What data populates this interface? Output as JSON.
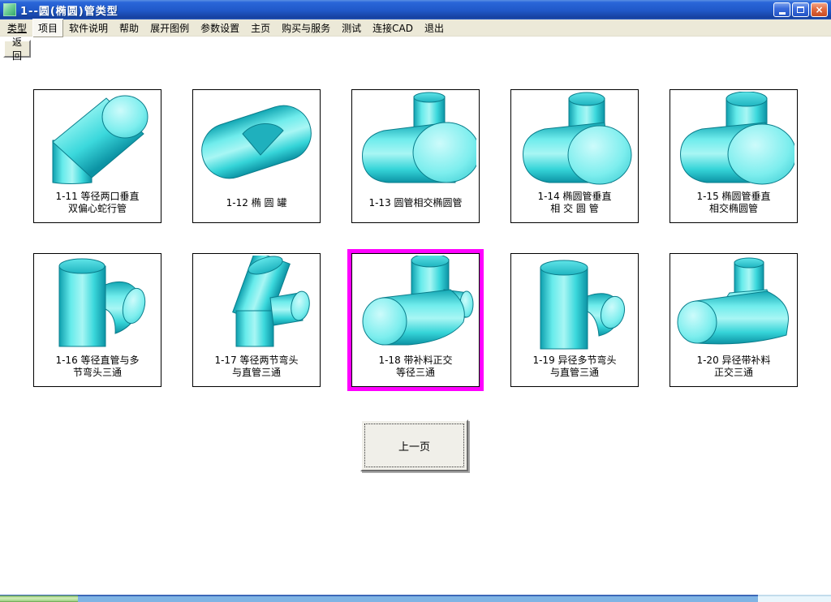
{
  "window": {
    "title": "1--圆(椭圆)管类型"
  },
  "titlebar": {
    "close_glyph": "×"
  },
  "menu": {
    "items": [
      {
        "label": "类型"
      },
      {
        "label": "项目"
      },
      {
        "label": "软件说明"
      },
      {
        "label": "帮助"
      },
      {
        "label": "展开图例"
      },
      {
        "label": "参数设置"
      },
      {
        "label": "主页"
      },
      {
        "label": "购买与服务"
      },
      {
        "label": "测试"
      },
      {
        "label": "连接CAD"
      },
      {
        "label": "退出"
      }
    ]
  },
  "toolbar": {
    "back_label": "返回"
  },
  "grid": {
    "items": [
      {
        "id": "1-11",
        "line1": "1-11 等径两口垂直",
        "line2": "双偏心蛇行管",
        "selected": false
      },
      {
        "id": "1-12",
        "line1": "1-12 椭 圆 罐",
        "line2": "",
        "selected": false
      },
      {
        "id": "1-13",
        "line1": "1-13 圆管相交椭圆管",
        "line2": "",
        "selected": false
      },
      {
        "id": "1-14",
        "line1": "1-14 椭圆管垂直",
        "line2": "相 交 圆 管",
        "selected": false
      },
      {
        "id": "1-15",
        "line1": "1-15 椭圆管垂直",
        "line2": "相交椭圆管",
        "selected": false
      },
      {
        "id": "1-16",
        "line1": "1-16 等径直管与多",
        "line2": "节弯头三通",
        "selected": false
      },
      {
        "id": "1-17",
        "line1": "1-17 等径两节弯头",
        "line2": "与直管三通",
        "selected": false
      },
      {
        "id": "1-18",
        "line1": "1-18 带补料正交",
        "line2": "等径三通",
        "selected": true
      },
      {
        "id": "1-19",
        "line1": "1-19 异径多节弯头",
        "line2": "与直管三通",
        "selected": false
      },
      {
        "id": "1-20",
        "line1": "1-20 异径带补料",
        "line2": "正交三通",
        "selected": false
      }
    ]
  },
  "pager": {
    "prev_label": "上一页"
  },
  "colors": {
    "pipe": "#3BDCDC",
    "selection": "#FF00FF",
    "titlebar": "#2058C8",
    "menu_bg": "#ECE9D8"
  }
}
